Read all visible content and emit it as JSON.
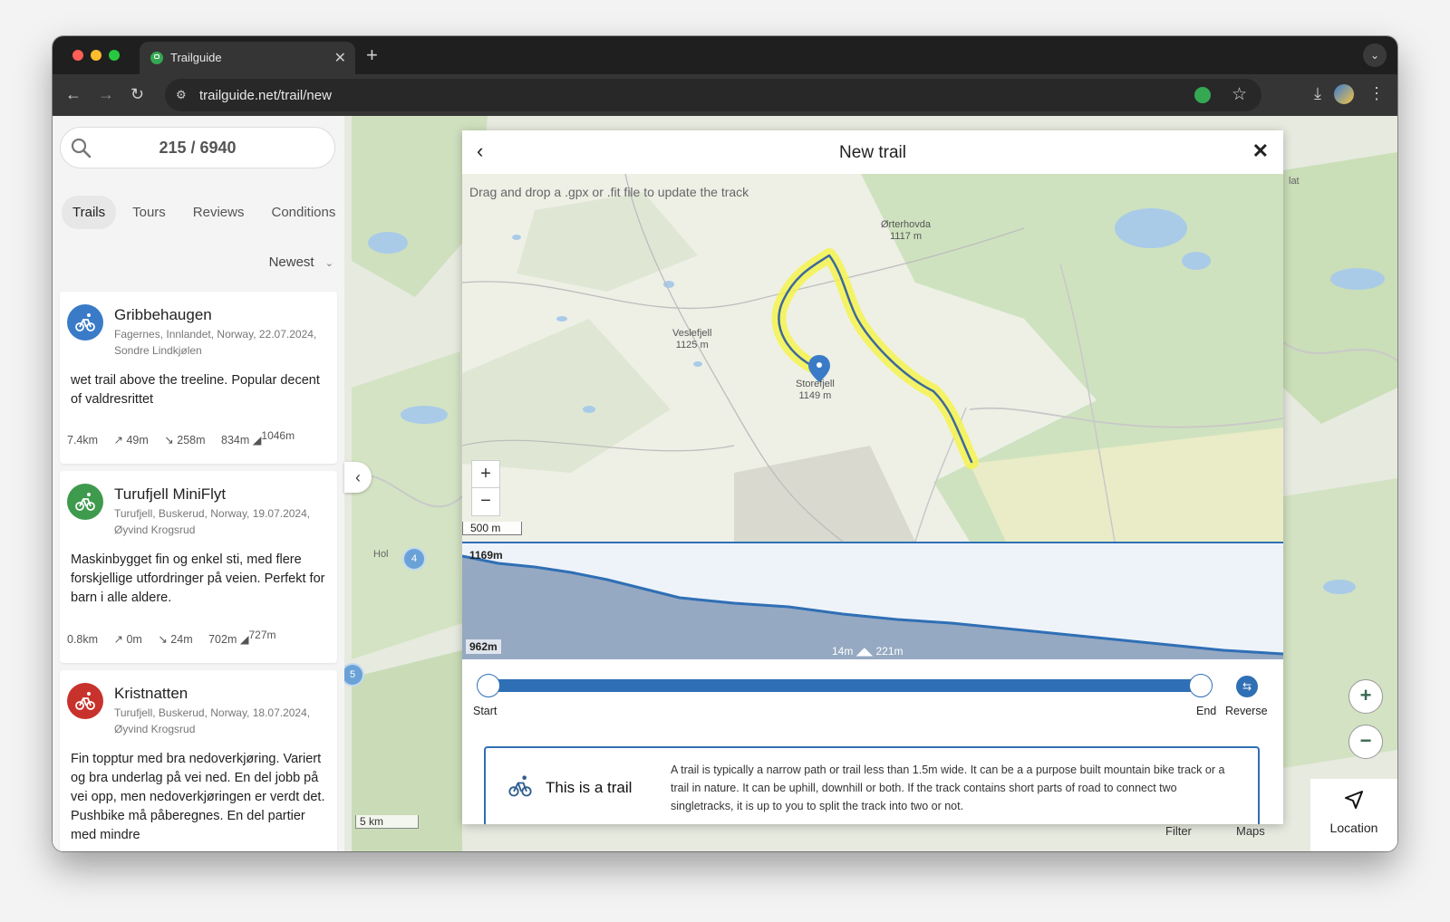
{
  "browser": {
    "tab_title": "Trailguide",
    "url": "trailguide.net/trail/new",
    "traffic_lights": [
      "#ff5f57",
      "#febc2e",
      "#28c840"
    ]
  },
  "sidebar": {
    "search_count": "215 / 6940",
    "tabs": [
      {
        "label": "Trails",
        "active": true
      },
      {
        "label": "Tours",
        "active": false
      },
      {
        "label": "Reviews",
        "active": false
      },
      {
        "label": "Conditions",
        "active": false
      }
    ],
    "sort_label": "Newest",
    "cards": [
      {
        "name": "Gribbehaugen",
        "location": "Fagernes, Innlandet, Norway, 22.07.2024,",
        "author": "Sondre Lindkjølen",
        "description": "wet trail above the treeline. Popular decent of valdresrittet",
        "distance": "7.4km",
        "climb": "49m",
        "descent": "258m",
        "min_alt": "834m",
        "max_alt": "1046m",
        "icon_color": "#3a7bc8"
      },
      {
        "name": "Turufjell MiniFlyt",
        "location": "Turufjell, Buskerud, Norway, 19.07.2024,",
        "author": "Øyvind Krogsrud",
        "description": "Maskinbygget fin og enkel sti, med flere forskjellige utfordringer på veien. Perfekt for barn i alle aldere.",
        "distance": "0.8km",
        "climb": "0m",
        "descent": "24m",
        "min_alt": "702m",
        "max_alt": "727m",
        "icon_color": "#3e9a4c"
      },
      {
        "name": "Kristnatten",
        "location": "Turufjell, Buskerud, Norway, 18.07.2024,",
        "author": "Øyvind Krogsrud",
        "description": "Fin topptur med bra nedoverkjøring. Variert og bra underlag på vei ned. En del jobb på vei opp, men nedoverkjøringen er verdt det. Pushbike må påberegnes. En del partier med mindre",
        "icon_color": "#c8322d"
      }
    ]
  },
  "map": {
    "scale_label": "5 km",
    "clusters": [
      "4",
      "5"
    ],
    "place_label": "Hol",
    "edge_label": "lat",
    "location_label": "Location",
    "peek_labels": [
      "Filter",
      "Maps"
    ]
  },
  "modal": {
    "title": "New trail",
    "hint": "Drag and drop a .gpx or .fit file to update the track",
    "scale_label": "500 m",
    "places": [
      {
        "name": "Ørterhovda",
        "alt": "1117 m"
      },
      {
        "name": "Veslefjell",
        "alt": "1125 m"
      },
      {
        "name": "Storefjell",
        "alt": "1149 m"
      }
    ],
    "elevation": {
      "max_label": "1169m",
      "min_label": "962m",
      "climb": "14m",
      "descent": "221m"
    },
    "slider": {
      "start_label": "Start",
      "end_label": "End",
      "reverse_label": "Reverse",
      "start": 0,
      "end": 1
    },
    "trail_type": {
      "heading": "This is a trail",
      "description": "A trail is typically a narrow path or trail less than 1.5m wide. It can be a a purpose built mountain bike track or a trail in nature. It can be uphill, downhill or both. If the track contains short parts of road to connect two singletracks, it is up to you to split the track into two or not."
    }
  }
}
